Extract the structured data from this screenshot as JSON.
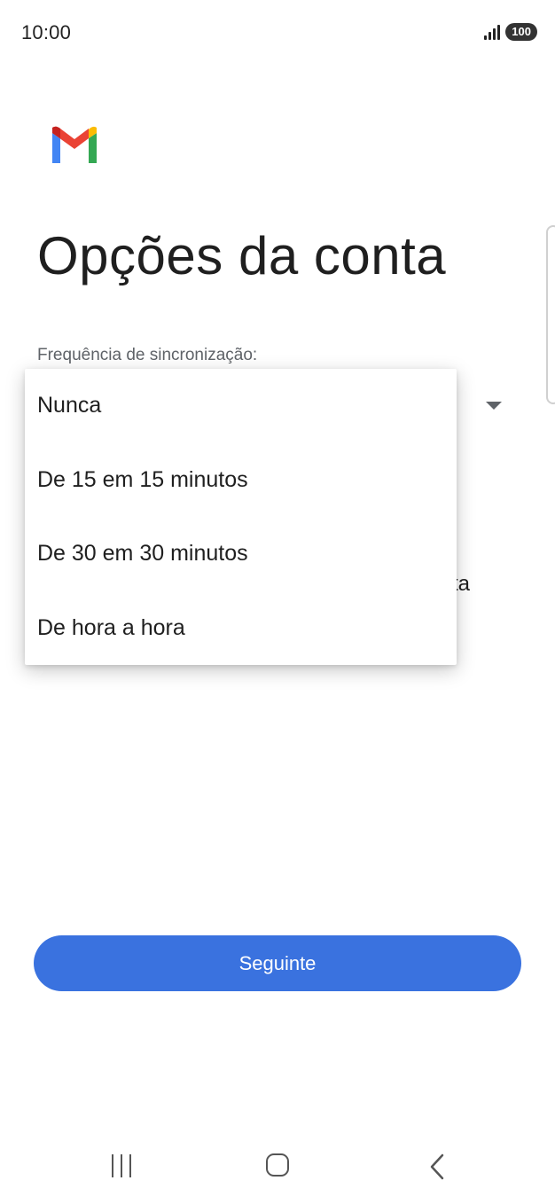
{
  "status_bar": {
    "time": "10:00",
    "battery": "100",
    "icons": [
      "signal-icon",
      "battery-icon"
    ]
  },
  "logo": {
    "name": "gmail-logo-icon",
    "colors": {
      "red": "#EA4335",
      "blue": "#4285F4",
      "green": "#34A853",
      "yellow": "#FBBC04",
      "dark_red": "#C5221F"
    }
  },
  "page": {
    "title": "Opções da conta",
    "sync_label": "Frequência de sincronização:",
    "background_fragment": "ta"
  },
  "dropdown": {
    "options": [
      {
        "label": "Nunca"
      },
      {
        "label": "De 15 em 15 minutos"
      },
      {
        "label": "De 30 em 30 minutos"
      },
      {
        "label": "De hora a hora"
      }
    ]
  },
  "actions": {
    "next_label": "Seguinte",
    "accent_color": "#3A72DF"
  },
  "nav_bar": {
    "icons": [
      "recents-icon",
      "home-icon",
      "back-icon"
    ]
  }
}
